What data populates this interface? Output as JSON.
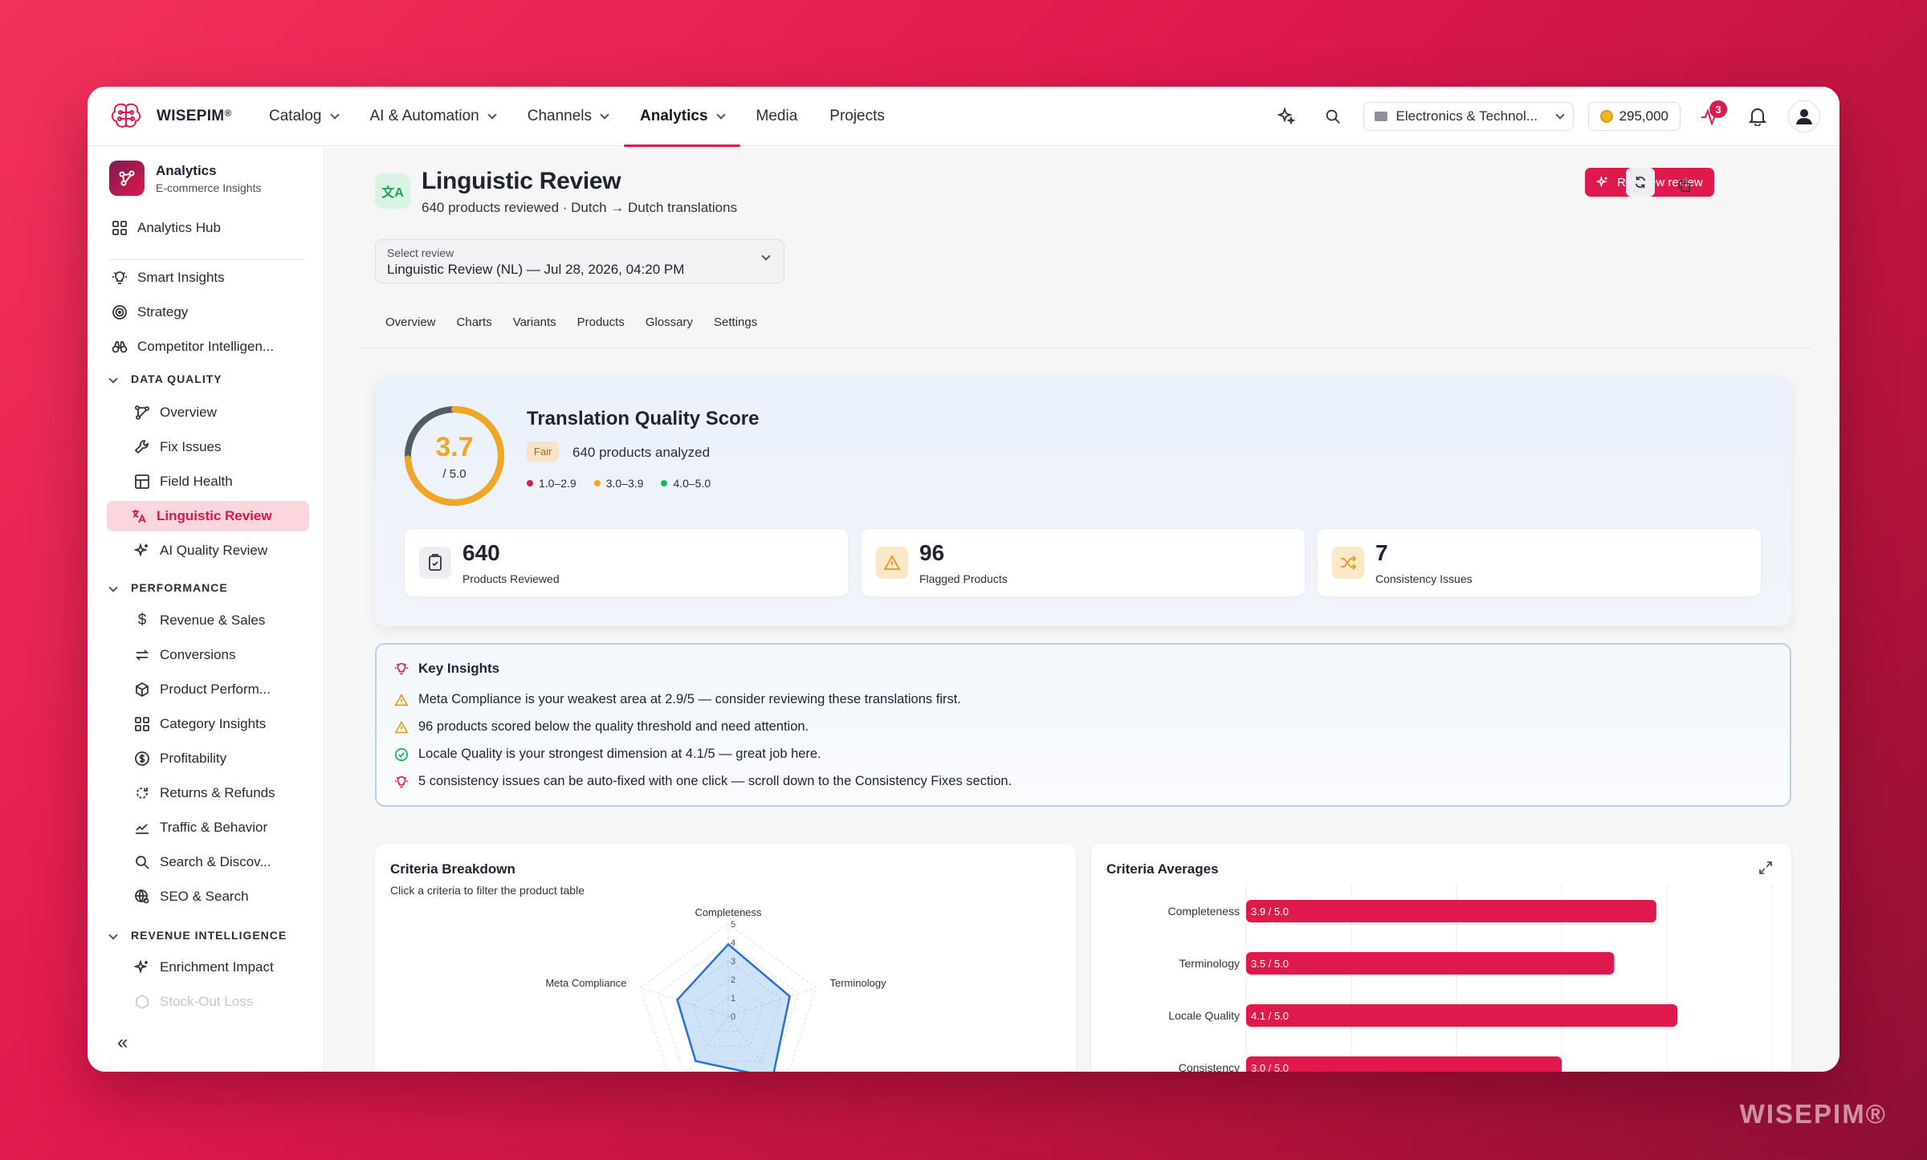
{
  "app": {
    "brand": "WISEPIM",
    "reg": "®",
    "watermark": "WISEPIM®"
  },
  "nav": {
    "items": [
      {
        "label": "Catalog",
        "dropdown": true
      },
      {
        "label": "AI & Automation",
        "dropdown": true
      },
      {
        "label": "Channels",
        "dropdown": true
      },
      {
        "label": "Analytics",
        "dropdown": true,
        "active": true
      },
      {
        "label": "Media",
        "dropdown": false
      },
      {
        "label": "Projects",
        "dropdown": false
      }
    ],
    "store": "Electronics & Technol...",
    "credits": "295,000",
    "activity_badge": "3"
  },
  "sidebar": {
    "title": "Analytics",
    "subtitle": "E-commerce Insights",
    "hub": "Analytics Hub",
    "top_items": [
      "Smart Insights",
      "Strategy",
      "Competitor Intelligen..."
    ],
    "sections": {
      "data_quality": "DATA QUALITY",
      "performance": "PERFORMANCE",
      "revenue": "REVENUE INTELLIGENCE"
    },
    "data_quality_items": [
      "Overview",
      "Fix Issues",
      "Field Health",
      "Linguistic Review",
      "AI Quality Review"
    ],
    "performance_items": [
      "Revenue & Sales",
      "Conversions",
      "Product Perform...",
      "Category Insights",
      "Profitability",
      "Returns & Refunds",
      "Traffic & Behavior",
      "Search & Discov...",
      "SEO & Search"
    ],
    "revenue_items": [
      "Enrichment Impact",
      "Stock-Out Loss"
    ],
    "collapse": "«"
  },
  "page": {
    "title": "Linguistic Review",
    "subtitle": "640 products reviewed · Dutch → Dutch translations",
    "icon_text": "文A",
    "run_button": "Run new review",
    "select_label": "Select review",
    "select_value": "Linguistic Review (NL) — Jul 28, 2026, 04:20 PM",
    "tabs": [
      "Overview",
      "Charts",
      "Variants",
      "Products",
      "Glossary",
      "Settings"
    ]
  },
  "score": {
    "title": "Translation Quality Score",
    "value": "3.7",
    "value_num": 3.7,
    "max": "/ 5.0",
    "rating": "Fair",
    "analyzed": "640 products analyzed",
    "legend": [
      {
        "label": "1.0–2.9",
        "color": "#e0194c"
      },
      {
        "label": "3.0–3.9",
        "color": "#f2a623"
      },
      {
        "label": "4.0–5.0",
        "color": "#22b35e"
      }
    ],
    "colors": {
      "fair": "#f2a623",
      "track": "#555b66"
    }
  },
  "stats": [
    {
      "value": "640",
      "label": "Products Reviewed",
      "icon": "clipboard-check-icon"
    },
    {
      "value": "96",
      "label": "Flagged Products",
      "icon": "warning-icon"
    },
    {
      "value": "7",
      "label": "Consistency Issues",
      "icon": "shuffle-icon"
    }
  ],
  "insights": {
    "title": "Key Insights",
    "items": [
      {
        "text": "Meta Compliance is your weakest area at 2.9/5 — consider reviewing these translations first.",
        "icon": "warning-icon"
      },
      {
        "text": "96 products scored below the quality threshold and need attention.",
        "icon": "warning-icon"
      },
      {
        "text": "Locale Quality is your strongest dimension at 4.1/5 — great job here.",
        "icon": "check-circle-icon"
      },
      {
        "text": "5 consistency issues can be auto-fixed with one click — scroll down to the Consistency Fixes section.",
        "icon": "lightbulb-icon"
      }
    ]
  },
  "criteria_breakdown": {
    "title": "Criteria Breakdown",
    "subtitle": "Click a criteria to filter the product table"
  },
  "criteria_averages": {
    "title": "Criteria Averages"
  },
  "chart_data": [
    {
      "type": "radar",
      "title": "Criteria Breakdown",
      "axes": [
        "Completeness",
        "Terminology",
        "Locale Quality",
        "Consistency",
        "Meta Compliance"
      ],
      "values": [
        3.9,
        3.5,
        4.1,
        3.0,
        2.9
      ],
      "tick_labels": [
        "0",
        "1",
        "2",
        "3",
        "4",
        "5"
      ],
      "range": [
        0,
        5
      ]
    },
    {
      "type": "bar",
      "orientation": "horizontal",
      "title": "Criteria Averages",
      "categories": [
        "Completeness",
        "Terminology",
        "Locale Quality",
        "Consistency"
      ],
      "values": [
        3.9,
        3.5,
        4.1,
        3.0
      ],
      "data_labels": [
        "3.9 / 5.0",
        "3.5 / 5.0",
        "4.1 / 5.0",
        "3.0 / 5.0"
      ],
      "xlim": [
        0,
        5
      ],
      "color": "#e0194c"
    }
  ]
}
